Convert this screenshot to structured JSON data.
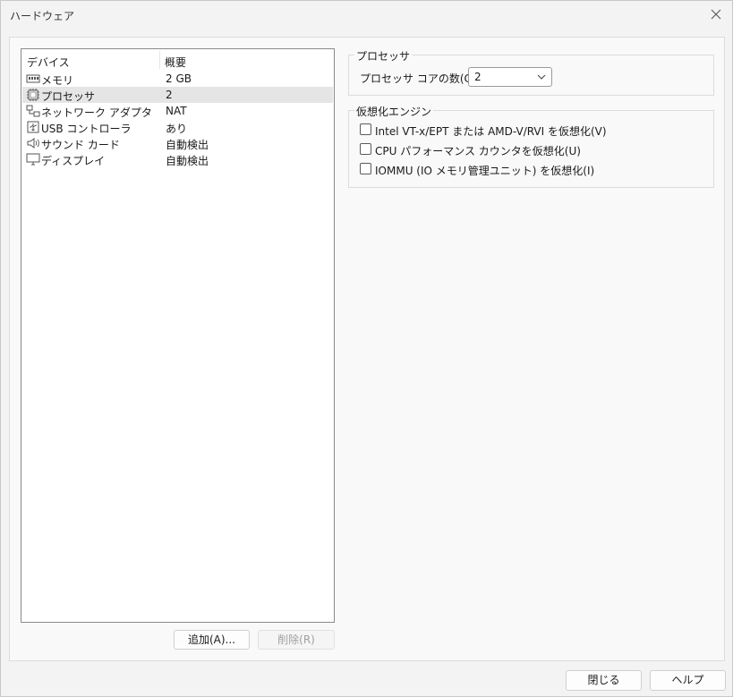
{
  "window": {
    "title": "ハードウェア"
  },
  "device_list": {
    "columns": [
      "デバイス",
      "概要"
    ],
    "rows": [
      {
        "name": "メモリ",
        "value": "2 GB",
        "icon": "memory-icon",
        "selected": false
      },
      {
        "name": "プロセッサ",
        "value": "2",
        "icon": "processor-icon",
        "selected": true
      },
      {
        "name": "ネットワーク アダプタ",
        "value": "NAT",
        "icon": "network-adapter-icon",
        "selected": false
      },
      {
        "name": "USB コントローラ",
        "value": "あり",
        "icon": "usb-icon",
        "selected": false
      },
      {
        "name": "サウンド カード",
        "value": "自動検出",
        "icon": "speaker-icon",
        "selected": false
      },
      {
        "name": "ディスプレイ",
        "value": "自動検出",
        "icon": "monitor-icon",
        "selected": false
      }
    ]
  },
  "list_buttons": {
    "add": "追加(A)...",
    "remove": "削除(R)"
  },
  "processor": {
    "group_label": "プロセッサ",
    "cores_label": "プロセッサ コアの数(C):",
    "cores_value": "2"
  },
  "virtualization": {
    "group_label": "仮想化エンジン",
    "options": [
      {
        "label": "Intel VT-x/EPT または AMD-V/RVI を仮想化(V)",
        "checked": false
      },
      {
        "label": "CPU パフォーマンス カウンタを仮想化(U)",
        "checked": false
      },
      {
        "label": "IOMMU (IO メモリ管理ユニット) を仮想化(I)",
        "checked": false
      }
    ]
  },
  "footer": {
    "close": "閉じる",
    "help": "ヘルプ"
  }
}
